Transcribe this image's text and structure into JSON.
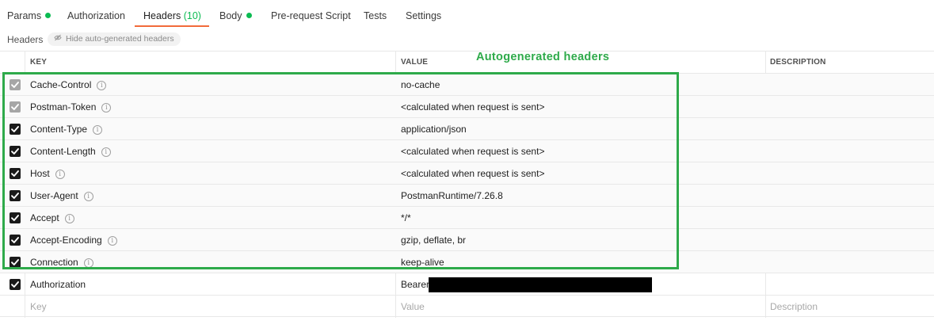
{
  "tabs": [
    {
      "label": "Params",
      "dot": true
    },
    {
      "label": "Authorization",
      "dot": false
    },
    {
      "label": "Headers",
      "count": "(10)",
      "active": true
    },
    {
      "label": "Body",
      "dot": true
    },
    {
      "label": "Pre-request Script",
      "dot": false
    },
    {
      "label": "Tests",
      "dot": false
    },
    {
      "label": "Settings",
      "dot": false
    }
  ],
  "subbar": {
    "title": "Headers",
    "hide_button": "Hide auto-generated headers",
    "hide_icon": "eye-off-icon"
  },
  "table": {
    "columns": {
      "key": "KEY",
      "value": "VALUE",
      "description": "DESCRIPTION"
    },
    "rows": [
      {
        "key": "Cache-Control",
        "value": "no-cache",
        "checked": true,
        "locked": true
      },
      {
        "key": "Postman-Token",
        "value": "<calculated when request is sent>",
        "checked": true,
        "locked": true
      },
      {
        "key": "Content-Type",
        "value": "application/json",
        "checked": true,
        "locked": false
      },
      {
        "key": "Content-Length",
        "value": "<calculated when request is sent>",
        "checked": true,
        "locked": false
      },
      {
        "key": "Host",
        "value": "<calculated when request is sent>",
        "checked": true,
        "locked": false
      },
      {
        "key": "User-Agent",
        "value": "PostmanRuntime/7.26.8",
        "checked": true,
        "locked": false
      },
      {
        "key": "Accept",
        "value": "*/*",
        "checked": true,
        "locked": false
      },
      {
        "key": "Accept-Encoding",
        "value": "gzip, deflate, br",
        "checked": true,
        "locked": false
      },
      {
        "key": "Connection",
        "value": "keep-alive",
        "checked": true,
        "locked": false
      },
      {
        "key": "Authorization",
        "value": "Bearer",
        "checked": true,
        "locked": false,
        "redacted": true
      }
    ],
    "new_row": {
      "key_placeholder": "Key",
      "value_placeholder": "Value",
      "description_placeholder": "Description"
    }
  },
  "annotation": {
    "label": "Autogenerated headers",
    "color": "#2eaa4a"
  },
  "colors": {
    "accent": "#f26b3a",
    "status_dot": "#0cbb52"
  }
}
